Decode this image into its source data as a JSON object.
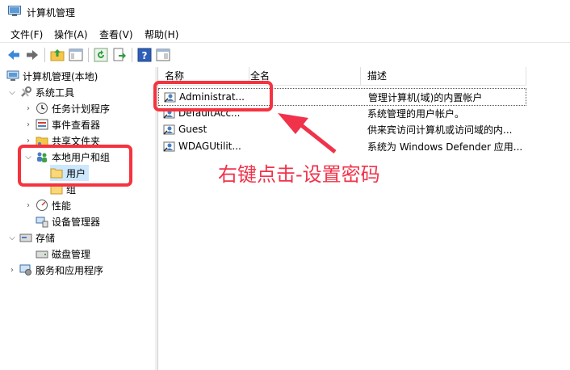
{
  "window": {
    "title": "计算机管理",
    "icon": "computer-management-icon"
  },
  "menu": [
    "文件(F)",
    "操作(A)",
    "查看(V)",
    "帮助(H)"
  ],
  "toolbar_icons": [
    "back-arrow-icon",
    "forward-arrow-icon",
    "up-folder-icon",
    "show-tree-icon",
    "refresh-icon",
    "export-list-icon",
    "help-icon",
    "console-view-icon"
  ],
  "tree": {
    "root": "计算机管理(本地)",
    "system_tools": "系统工具",
    "task_scheduler": "任务计划程序",
    "event_viewer": "事件查看器",
    "shared_folders": "共享文件夹",
    "local_users_groups": "本地用户和组",
    "users": "用户",
    "groups": "组",
    "performance": "性能",
    "device_manager": "设备管理器",
    "storage": "存储",
    "disk_management": "磁盘管理",
    "services_apps": "服务和应用程序"
  },
  "columns": {
    "name": "名称",
    "fullname": "全名",
    "description": "描述"
  },
  "users": [
    {
      "name": "Administrat...",
      "description": "管理计算机(域)的内置帐户"
    },
    {
      "name": "DefaultAcc...",
      "description": "系统管理的用户帐户。"
    },
    {
      "name": "Guest",
      "description": "供来宾访问计算机或访问域的内..."
    },
    {
      "name": "WDAGUtilit...",
      "description": "系统为 Windows Defender 应用..."
    }
  ],
  "annotation": "右键点击-设置密码",
  "colors": {
    "highlight_red": "#f5333f",
    "annotation_red": "#f0334a"
  }
}
